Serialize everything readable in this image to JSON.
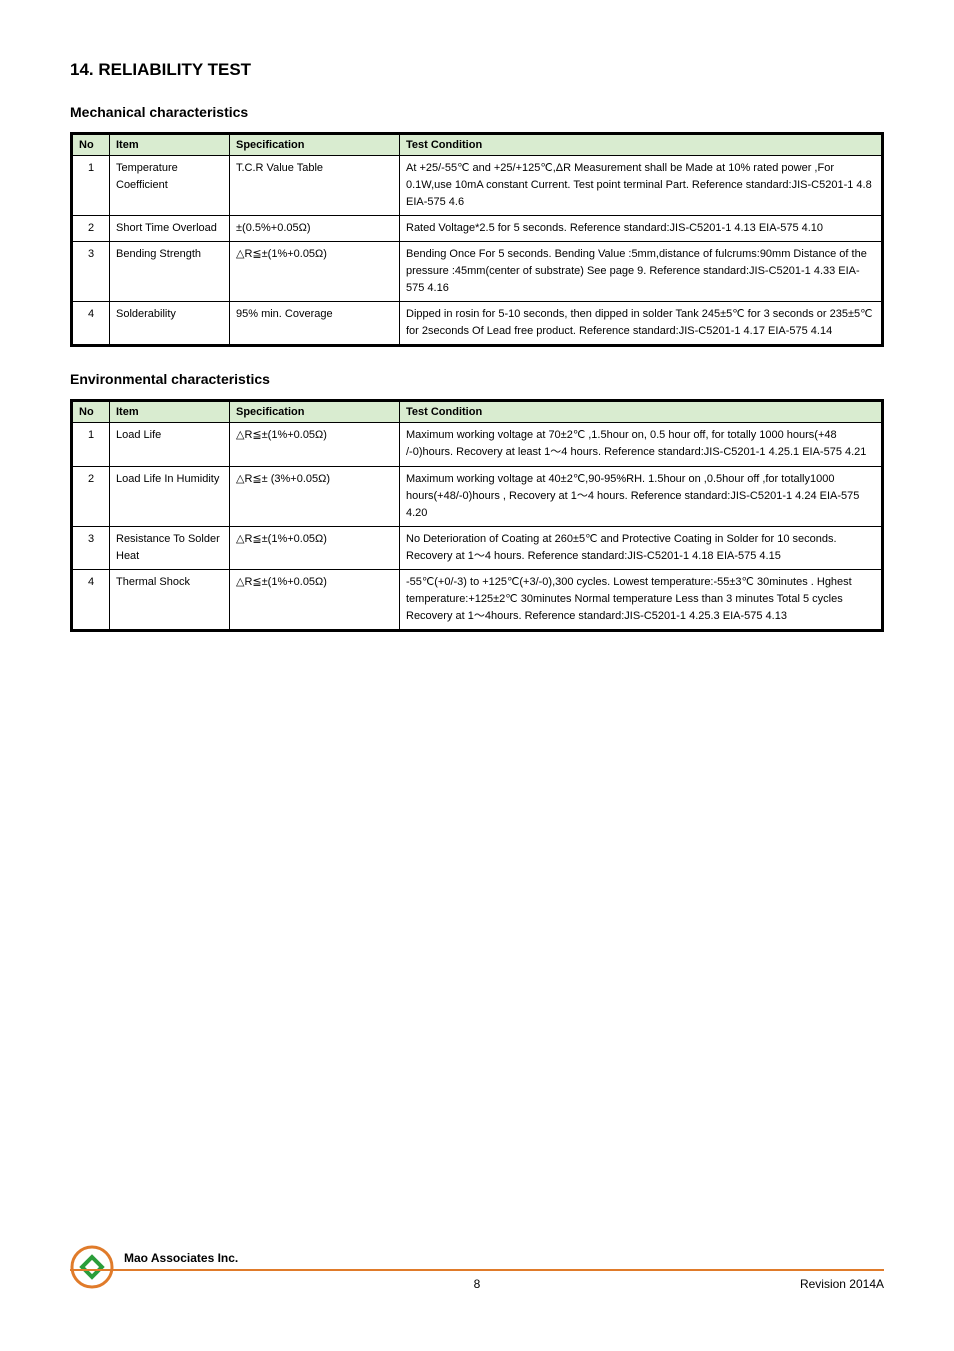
{
  "heading": "14. RELIABILITY TEST",
  "section1": {
    "title": "Mechanical characteristics",
    "headers": {
      "no": "No",
      "item": "Item",
      "spec": "Specification",
      "cond": "Test Condition"
    },
    "rows": [
      {
        "no": "1",
        "item": "Temperature Coefficient",
        "spec": "T.C.R Value Table",
        "cond": "At +25/-55℃ and +25/+125℃,ΔR Measurement shall be Made at 10% rated power ,For 0.1W,use 10mA constant Current. Test point terminal Part. Reference standard:JIS-C5201-1 4.8  EIA-575 4.6"
      },
      {
        "no": "2",
        "item": "Short Time Overload",
        "spec": "±(0.5%+0.05Ω)",
        "cond": "Rated Voltage*2.5 for 5 seconds. Reference standard:JIS-C5201-1 4.13  EIA-575 4.10"
      },
      {
        "no": "3",
        "item": "Bending Strength",
        "spec": "△R≦±(1%+0.05Ω)",
        "cond": "Bending Once For 5 seconds. Bending Value :5mm,distance of fulcrums:90mm Distance of the pressure :45mm(center of substrate)  See page 9. Reference standard:JIS-C5201-1 4.33  EIA-575 4.16"
      },
      {
        "no": "4",
        "item": "Solderability",
        "spec": "95% min. Coverage",
        "cond": "Dipped in rosin for 5-10 seconds, then dipped in solder Tank 245±5℃ for 3 seconds or 235±5℃ for 2seconds Of Lead free product. Reference standard:JIS-C5201-1 4.17  EIA-575 4.14"
      }
    ]
  },
  "section2": {
    "title": "Environmental characteristics",
    "headers": {
      "no": "No",
      "item": "Item",
      "spec": "Specification",
      "cond": "Test Condition"
    },
    "rows": [
      {
        "no": "1",
        "item": "Load Life",
        "spec": "△R≦±(1%+0.05Ω)",
        "cond": "Maximum working voltage at 70±2℃ ,1.5hour on, 0.5 hour off, for totally 1000 hours(+48 /-0)hours. Recovery at least 1～4 hours. Reference standard:JIS-C5201-1 4.25.1  EIA-575 4.21"
      },
      {
        "no": "2",
        "item": "Load Life In Humidity",
        "spec": "△R≦± (3%+0.05Ω)",
        "cond": "Maximum working voltage at 40±2℃,90-95%RH. 1.5hour on ,0.5hour off ,for totally1000 hours(+48/-0)hours , Recovery at 1～4 hours. Reference standard:JIS-C5201-1 4.24  EIA-575 4.20"
      },
      {
        "no": "3",
        "item": "Resistance To Solder Heat",
        "spec": "△R≦±(1%+0.05Ω)",
        "cond": "No Deterioration of Coating at 260±5℃ and Protective Coating in Solder for 10 seconds. Recovery at 1～4 hours. Reference standard:JIS-C5201-1 4.18  EIA-575 4.15"
      },
      {
        "no": "4",
        "item": "Thermal Shock",
        "spec": "△R≦±(1%+0.05Ω)",
        "cond": "-55℃(+0/-3) to +125℃(+3/-0),300 cycles. Lowest temperature:-55±3℃ 30minutes . Hghest temperature:+125±2℃ 30minutes Normal temperature Less than 3 minutes Total 5 cycles Recovery at 1～4hours. Reference standard:JIS-C5201-1 4.25.3  EIA-575 4.13"
      }
    ]
  },
  "footer": {
    "company": "Mao Associates Inc.",
    "page": "8",
    "rev": "Revision 2014A"
  }
}
